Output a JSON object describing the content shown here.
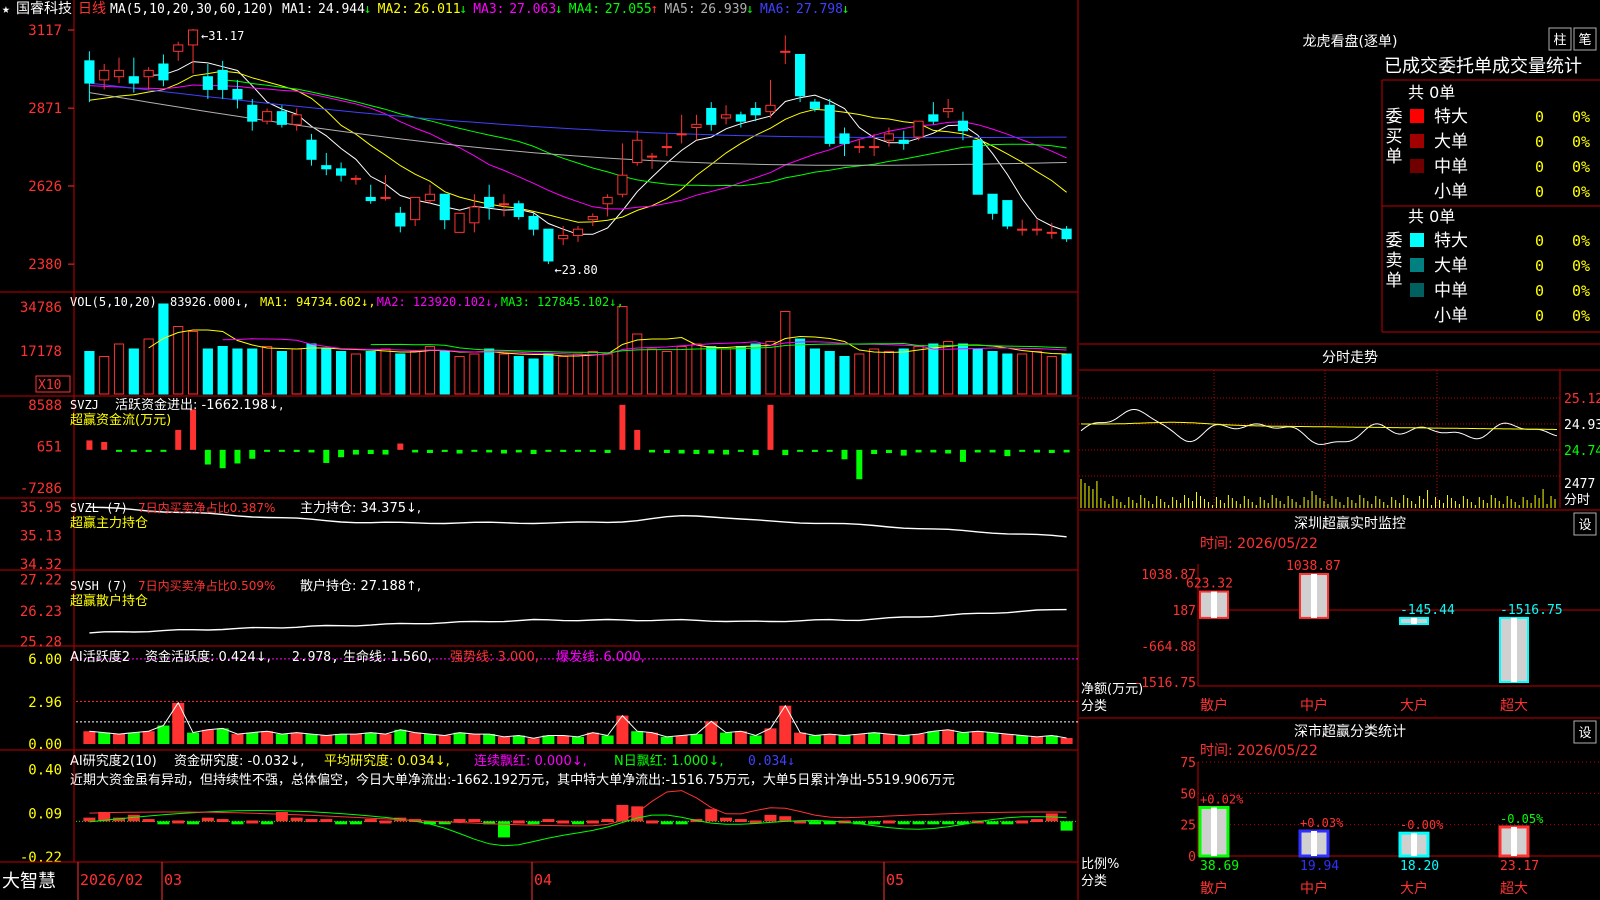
{
  "colors": {
    "up": "#ff3232",
    "down": "#00ffff",
    "grid": "#c00000",
    "axis": "#ff3232",
    "yellow": "#ffff00",
    "magenta": "#ff00ff",
    "green": "#00ff00",
    "white": "#ffffff",
    "blue": "#4040ff",
    "gray": "#b0b0b0"
  },
  "header": {
    "star": "★",
    "stock": "国睿科技",
    "period": "日线",
    "ma_params": "MA(5,10,20,30,60,120)",
    "ma": [
      {
        "label": "MA1:",
        "value": "24.944",
        "arrow": "↓",
        "color": "#ffffff"
      },
      {
        "label": "MA2:",
        "value": "26.011",
        "arrow": "↓",
        "color": "#ffff00"
      },
      {
        "label": "MA3:",
        "value": "27.063",
        "arrow": "↓",
        "color": "#ff00ff"
      },
      {
        "label": "MA4:",
        "value": "27.055",
        "arrow": "↑",
        "color": "#00ff00"
      },
      {
        "label": "MA5:",
        "value": "26.939",
        "arrow": "↓",
        "color": "#b0b0b0"
      },
      {
        "label": "MA6:",
        "value": "27.798",
        "arrow": "↓",
        "color": "#4040ff"
      }
    ]
  },
  "price_axis": [
    "3117",
    "2871",
    "2626",
    "2380"
  ],
  "price_annotations": {
    "high": "31.17",
    "low": "23.80"
  },
  "volume": {
    "label": "VOL(5,10,20)",
    "value": "83926.000",
    "arrow": "↓",
    "ma": [
      {
        "label": "MA1:",
        "value": "94734.602",
        "arrow": "↓",
        "color": "#ffff00"
      },
      {
        "label": "MA2:",
        "value": "123920.102",
        "arrow": "↓",
        "color": "#ff00ff"
      },
      {
        "label": "MA3:",
        "value": "127845.102",
        "arrow": "↓",
        "color": "#00ff00"
      }
    ],
    "axis": [
      "34786",
      "17178"
    ],
    "unit": "X10"
  },
  "svzj": {
    "title": "SVZJ",
    "desc": "活跃资金进出:",
    "value": "-1662.198",
    "arrow": "↓",
    "sub": "超赢资金流(万元)",
    "axis": [
      "8588",
      "651",
      "-7286"
    ]
  },
  "svzl": {
    "title": "SVZL (7)",
    "desc": "7日内买卖净占比0.387%",
    "hold_label": "主力持仓:",
    "hold": "34.375",
    "arrow": "↓",
    "sub": "超赢主力持仓",
    "axis": [
      "35.95",
      "35.13",
      "34.32"
    ]
  },
  "svsh": {
    "title": "SVSH (7)",
    "desc": "7日内买卖净占比0.509%",
    "hold_label": "散户持仓:",
    "hold": "27.188",
    "arrow": "↑",
    "sub": "超赢散户持仓",
    "axis": [
      "27.22",
      "26.23",
      "25.28"
    ]
  },
  "ai1": {
    "title": "AI活跃度2",
    "p1": "资金活跃度: 0.424",
    "a1": "↓",
    "p2": "2.978,",
    "p3": "生命线: 1.560,",
    "p4": "强势线: 3.000,",
    "p5": "爆发线: 6.000,",
    "axis": [
      "6.00",
      "2.96",
      "0.00"
    ]
  },
  "ai2": {
    "title": "AI研究度2(10)",
    "p1": "资金研究度: -0.032",
    "a1": "↓",
    "p2": "平均研究度: 0.034",
    "a2": "↓",
    "p3": "连续飘红: 0.000",
    "a3": "↓",
    "p4": "N日飘红: 1.000",
    "a4": "↓",
    "p5": "0.034",
    "a5": "↓",
    "comment": "近期大资金虽有异动，但持续性不强，总体偏空，今日大单净流出:-1662.192万元，其中特大单净流出:-1516.75万元，大单5日累计净出-5519.906万元",
    "axis": [
      "0.40",
      "0.09",
      "-0.22"
    ]
  },
  "date_axis": {
    "brand": "大智慧",
    "labels": [
      "2026/02",
      "03",
      "04",
      "05"
    ]
  },
  "lhb": {
    "title": "龙虎看盘(逐单)",
    "btn1": "柱",
    "btn2": "笔",
    "subtitle": "已成交委托单成交量统计",
    "buy_label": "委买单",
    "sell_label": "委卖单",
    "buy_total": "共 0单",
    "sell_total": "共 0单",
    "buy_rows": [
      {
        "name": "特大",
        "count": "0",
        "pct": "0%",
        "color": "#ff0000"
      },
      {
        "name": "大单",
        "count": "0",
        "pct": "0%",
        "color": "#a00000"
      },
      {
        "name": "中单",
        "count": "0",
        "pct": "0%",
        "color": "#700000"
      },
      {
        "name": "小单",
        "count": "0",
        "pct": "0%",
        "color": ""
      }
    ],
    "sell_rows": [
      {
        "name": "特大",
        "count": "0",
        "pct": "0%",
        "color": "#00ffff"
      },
      {
        "name": "大单",
        "count": "0",
        "pct": "0%",
        "color": "#008080"
      },
      {
        "name": "中单",
        "count": "0",
        "pct": "0%",
        "color": "#006060"
      },
      {
        "name": "小单",
        "count": "0",
        "pct": "0%",
        "color": ""
      }
    ]
  },
  "intraday": {
    "title": "分时走势",
    "axis": [
      "25.12",
      "24.93",
      "24.74"
    ],
    "vol": "2477",
    "vol_unit": "分时"
  },
  "sz_monitor": {
    "title": "深圳超赢实时监控",
    "btn": "设",
    "time": "时间: 2026/05/22",
    "axis": [
      "1038.87",
      "187",
      "-664.88",
      "-1516.75"
    ],
    "ylabel1": "净额(万元)",
    "ylabel2": "分类",
    "categories": [
      "散户",
      "中户",
      "大户",
      "超大"
    ],
    "values": [
      623.32,
      1038.87,
      -145.44,
      -1516.75
    ],
    "labels": [
      "623.32",
      "1038.87",
      "-145.44",
      "-1516.75"
    ]
  },
  "sz_class": {
    "title": "深市超赢分类统计",
    "btn": "设",
    "time": "时间: 2026/05/22",
    "axis": [
      "75",
      "50",
      "25",
      "0"
    ],
    "ylabel1": "比例%",
    "ylabel2": "分类",
    "categories": [
      "散户",
      "中户",
      "大户",
      "超大"
    ],
    "pcts": [
      "+0.02%",
      "+0.03%",
      "-0.00%",
      "-0.05%"
    ],
    "values": [
      38.69,
      19.94,
      18.2,
      23.17
    ],
    "labels": [
      "38.69",
      "19.94",
      "18.20",
      "23.17"
    ]
  },
  "chart_data": {
    "type": "bar",
    "title": "深圳超赢实时监控",
    "xlabel": "分类",
    "ylabel": "净额(万元)",
    "categories": [
      "散户",
      "中户",
      "大户",
      "超大"
    ],
    "values": [
      623.32,
      1038.87,
      -145.44,
      -1516.75
    ],
    "ylim": [
      -1516.75,
      1038.87
    ]
  },
  "candles": [
    [
      30.2,
      29.5,
      30.5,
      28.9
    ],
    [
      29.6,
      29.9,
      30.1,
      29.3
    ],
    [
      29.7,
      29.9,
      30.3,
      29.5
    ],
    [
      29.7,
      29.5,
      30.3,
      29.2
    ],
    [
      29.7,
      29.9,
      30.0,
      29.3
    ],
    [
      30.1,
      29.6,
      30.4,
      29.4
    ],
    [
      30.5,
      30.7,
      30.8,
      30.2
    ],
    [
      30.7,
      31.17,
      31.2,
      29.8
    ],
    [
      29.7,
      29.3,
      30.1,
      29.0
    ],
    [
      29.9,
      29.3,
      30.2,
      29.0
    ],
    [
      29.3,
      29.0,
      29.6,
      28.7
    ],
    [
      28.8,
      28.3,
      29.0,
      28.0
    ],
    [
      28.3,
      28.6,
      28.7,
      28.2
    ],
    [
      28.6,
      28.2,
      28.8,
      28.1
    ],
    [
      28.2,
      28.5,
      28.7,
      28.0
    ],
    [
      27.7,
      27.1,
      27.9,
      26.9
    ],
    [
      26.9,
      26.8,
      27.3,
      26.6
    ],
    [
      26.8,
      26.6,
      27.0,
      26.4
    ],
    [
      26.5,
      26.5,
      26.6,
      26.3
    ],
    [
      25.9,
      25.8,
      26.3,
      25.7
    ],
    [
      25.9,
      25.9,
      26.6,
      25.8
    ],
    [
      25.4,
      25.0,
      25.6,
      24.8
    ],
    [
      25.2,
      25.9,
      25.9,
      25.0
    ],
    [
      25.8,
      26.0,
      26.3,
      25.7
    ],
    [
      26.0,
      25.2,
      26.0,
      24.9
    ],
    [
      24.8,
      25.4,
      25.4,
      24.8
    ],
    [
      25.1,
      25.6,
      26.0,
      24.8
    ],
    [
      25.9,
      25.6,
      26.3,
      25.2
    ],
    [
      25.7,
      25.7,
      26.0,
      25.3
    ],
    [
      25.7,
      25.3,
      25.8,
      25.2
    ],
    [
      25.3,
      24.9,
      25.4,
      24.7
    ],
    [
      24.9,
      23.9,
      24.9,
      23.8
    ],
    [
      24.6,
      24.7,
      25.0,
      24.4
    ],
    [
      24.7,
      24.9,
      25.0,
      24.5
    ],
    [
      25.2,
      25.3,
      25.4,
      25.0
    ],
    [
      25.7,
      25.9,
      26.0,
      25.3
    ],
    [
      26.0,
      26.6,
      27.6,
      25.9
    ],
    [
      27.0,
      27.7,
      28.0,
      26.9
    ],
    [
      27.2,
      27.2,
      27.3,
      26.8
    ],
    [
      27.5,
      27.5,
      27.9,
      27.2
    ],
    [
      27.9,
      27.9,
      28.5,
      27.6
    ],
    [
      28.1,
      28.2,
      28.5,
      27.7
    ],
    [
      28.7,
      28.2,
      28.9,
      28.0
    ],
    [
      28.4,
      28.5,
      28.8,
      28.2
    ],
    [
      28.5,
      28.3,
      28.6,
      28.1
    ],
    [
      28.7,
      28.5,
      28.9,
      28.3
    ],
    [
      28.6,
      28.8,
      29.6,
      28.4
    ],
    [
      30.5,
      30.5,
      31.0,
      30.1
    ],
    [
      30.4,
      29.1,
      30.4,
      28.9
    ],
    [
      28.9,
      28.7,
      29.0,
      28.6
    ],
    [
      28.8,
      27.6,
      29.0,
      27.5
    ],
    [
      27.9,
      27.6,
      28.1,
      27.2
    ],
    [
      27.5,
      27.5,
      27.7,
      27.3
    ],
    [
      27.5,
      27.5,
      27.9,
      27.2
    ],
    [
      27.7,
      27.9,
      28.1,
      27.5
    ],
    [
      27.7,
      27.6,
      28.0,
      27.4
    ],
    [
      27.8,
      28.3,
      28.3,
      27.7
    ],
    [
      28.5,
      28.3,
      28.9,
      28.2
    ],
    [
      28.6,
      28.7,
      29.0,
      28.4
    ],
    [
      28.3,
      28.0,
      28.6,
      27.7
    ],
    [
      27.7,
      26.0,
      27.7,
      26.0
    ],
    [
      26.0,
      25.4,
      26.0,
      25.2
    ],
    [
      25.8,
      25.0,
      25.8,
      24.9
    ],
    [
      24.9,
      24.9,
      25.2,
      24.7
    ],
    [
      24.9,
      24.9,
      25.2,
      24.7
    ],
    [
      24.8,
      24.8,
      25.1,
      24.6
    ],
    [
      24.9,
      24.6,
      25.0,
      24.5
    ]
  ],
  "vols": [
    17,
    15,
    20,
    18,
    22,
    36,
    27,
    25,
    18,
    19,
    18,
    18,
    19,
    17,
    18,
    20,
    18,
    17,
    16,
    17,
    18,
    16,
    17,
    19,
    17,
    15,
    16,
    18,
    16,
    15,
    14,
    16,
    15,
    16,
    17,
    16,
    35,
    24,
    18,
    17,
    19,
    20,
    19,
    18,
    19,
    20,
    21,
    33,
    22,
    18,
    17,
    15,
    16,
    18,
    17,
    18,
    19,
    20,
    21,
    20,
    18,
    17,
    16,
    16,
    17,
    15,
    16
  ],
  "svzj_vals": [
    1800,
    1500,
    -200,
    -300,
    -400,
    -200,
    3800,
    7700,
    -2800,
    -3500,
    -2600,
    -1700,
    -300,
    -200,
    -400,
    -500,
    -2500,
    -1400,
    -900,
    -800,
    -900,
    1200,
    -500,
    -600,
    -400,
    -700,
    -200,
    -500,
    -700,
    -500,
    -800,
    -300,
    -400,
    -200,
    -400,
    -600,
    8588,
    3800,
    -500,
    -600,
    -700,
    -800,
    -700,
    -900,
    -200,
    -1000,
    8588,
    -1000,
    -300,
    -400,
    -300,
    -1800,
    -5600,
    -800,
    -600,
    -1100,
    -500,
    -500,
    -700,
    -2300,
    -500,
    -500,
    -1200,
    -300,
    -500,
    -600,
    -500
  ],
  "ai1_vals": [
    0.9,
    0.8,
    0.7,
    0.8,
    0.9,
    1.3,
    2.9,
    0.8,
    1.0,
    1.1,
    0.7,
    0.8,
    0.9,
    0.7,
    0.8,
    0.7,
    0.6,
    0.7,
    0.7,
    0.8,
    0.7,
    1.0,
    0.8,
    0.7,
    0.6,
    0.8,
    0.7,
    0.7,
    0.5,
    0.6,
    0.4,
    0.6,
    0.6,
    0.5,
    0.8,
    0.6,
    2.0,
    0.9,
    0.8,
    0.5,
    0.6,
    0.7,
    1.6,
    0.8,
    0.9,
    0.6,
    1.1,
    2.7,
    0.8,
    0.6,
    0.7,
    0.6,
    0.7,
    0.8,
    0.7,
    0.6,
    0.7,
    0.9,
    1.0,
    0.8,
    0.9,
    0.8,
    0.7,
    0.6,
    0.5,
    0.6,
    0.424
  ],
  "ai2_vals": [
    0.06,
    0.1,
    0.06,
    0.08,
    0.05,
    0.02,
    0.04,
    0.03,
    0.06,
    0.05,
    0.03,
    0.04,
    0.03,
    0.1,
    0.06,
    0.05,
    0.05,
    0.03,
    0.03,
    0.05,
    0.04,
    0.06,
    0.05,
    0.03,
    0.03,
    0.05,
    0.05,
    0.03,
    -0.08,
    0.04,
    0.02,
    0.05,
    0.04,
    0.03,
    0.04,
    0.05,
    0.15,
    0.14,
    0.04,
    0.03,
    0.03,
    0.05,
    0.12,
    0.06,
    0.05,
    0.04,
    0.08,
    0.07,
    0.04,
    0.03,
    0.02,
    0.04,
    0.03,
    0.03,
    0.04,
    0.03,
    0.02,
    0.03,
    0.03,
    0.03,
    0.04,
    0.03,
    0.03,
    0.04,
    0.05,
    0.09,
    -0.032
  ]
}
